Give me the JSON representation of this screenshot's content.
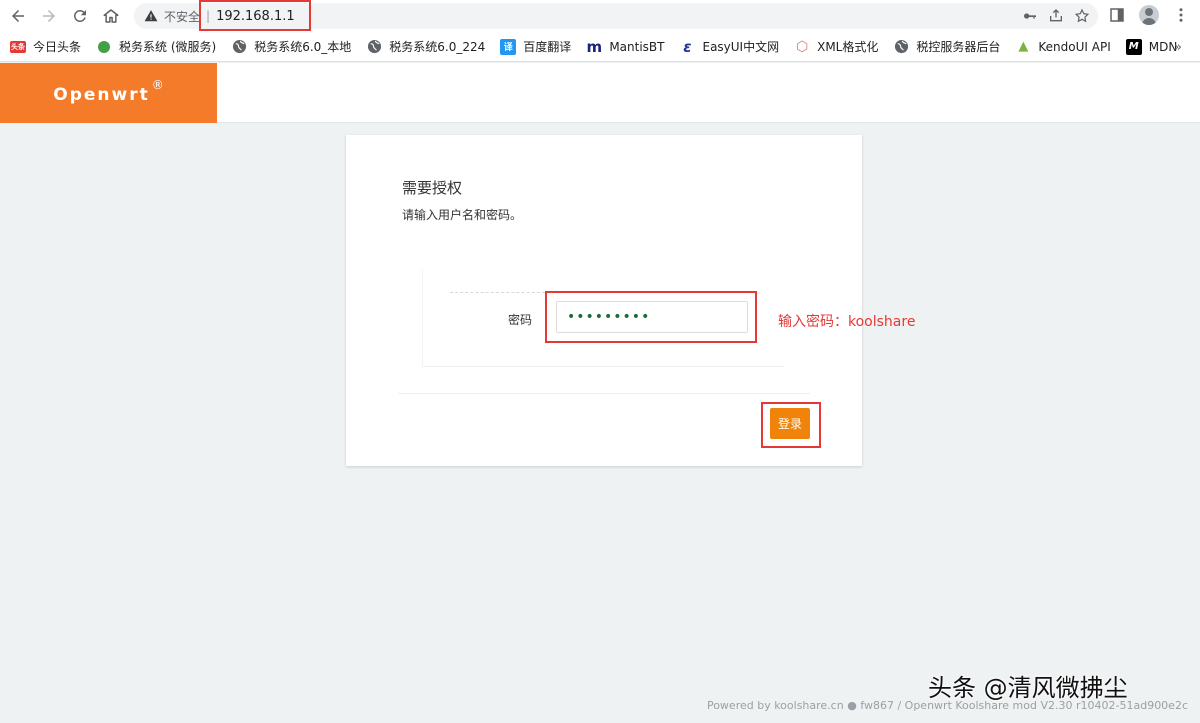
{
  "browser": {
    "security_text": "不安全",
    "separator": "|",
    "url": "192.168.1.1"
  },
  "bookmarks": [
    {
      "label": "今日头条",
      "icon": "toutiao-icon",
      "icon_text": "头条",
      "color": "#e53935"
    },
    {
      "label": "税务系统 (微服务)",
      "icon": "green-circle-icon",
      "icon_text": "",
      "color": "#43a047"
    },
    {
      "label": "税务系统6.0_本地",
      "icon": "globe-icon",
      "icon_text": "",
      "color": "#5f6368"
    },
    {
      "label": "税务系统6.0_224",
      "icon": "globe-icon",
      "icon_text": "",
      "color": "#5f6368"
    },
    {
      "label": "百度翻译",
      "icon": "baidu-translate-icon",
      "icon_text": "译",
      "color": "#2196f3"
    },
    {
      "label": "MantisBT",
      "icon": "mantis-icon",
      "icon_text": "m",
      "color": "#1a237e"
    },
    {
      "label": "EasyUI中文网",
      "icon": "easyui-icon",
      "icon_text": "ɛ",
      "color": "#283593"
    },
    {
      "label": "XML格式化",
      "icon": "cube-icon",
      "icon_text": "⬡",
      "color": "#e57373"
    },
    {
      "label": "税控服务器后台",
      "icon": "globe-icon",
      "icon_text": "",
      "color": "#5f6368"
    },
    {
      "label": "KendoUI API",
      "icon": "kendo-icon",
      "icon_text": "▲",
      "color": "#7cb342"
    },
    {
      "label": "MDN",
      "icon": "mdn-icon",
      "icon_text": "M",
      "color": "#000000"
    }
  ],
  "more_bookmarks": "»",
  "app": {
    "brand": "Openwrt",
    "brand_mark": "®"
  },
  "login": {
    "title": "需要授权",
    "description": "请输入用户名和密码。",
    "password_label": "密码",
    "password_value": "•••••••••",
    "submit_label": "登录"
  },
  "annotation": "输入密码：koolshare",
  "watermark": "头条 @清风微拂尘",
  "footer": "Powered by koolshare.cn ● fw867 / Openwrt Koolshare mod V2.30 r10402-51ad900e2c"
}
